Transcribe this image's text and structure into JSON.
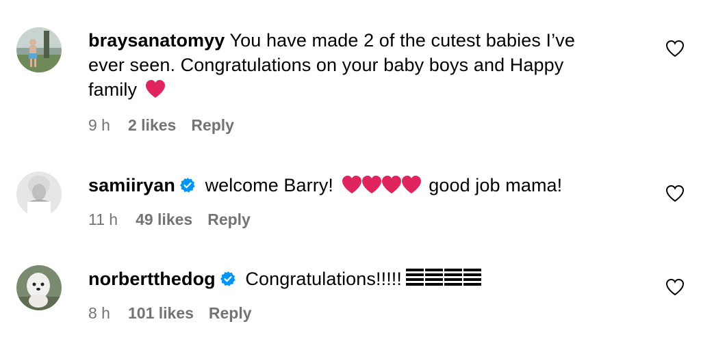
{
  "comments": [
    {
      "username": "braysanatomyy",
      "text_line1": " You have made 2 of the cutest babies I’ve",
      "text_line2": "ever seen. Congratulations on your baby boys and Happy",
      "text_line3": "family",
      "verified": false,
      "time": "9 h",
      "likes": "2 likes",
      "reply": "Reply",
      "emoji": "red-heart"
    },
    {
      "username": "samiiryan",
      "text_before": " welcome Barry! ",
      "text_after": " good job mama!",
      "verified": true,
      "time": "11 h",
      "likes": "49 likes",
      "reply": "Reply",
      "emoji": "red-heart x4"
    },
    {
      "username": "norbertthedog",
      "text": " Congratulations!!!!!",
      "verified": true,
      "time": "8 h",
      "likes": "101 likes",
      "reply": "Reply",
      "emoji": "striped-block x4"
    }
  ],
  "icons": {
    "like": "heart-outline-icon",
    "verified": "verified-badge-icon"
  },
  "colors": {
    "text": "#000000",
    "meta": "#737373",
    "verified": "#0095f6",
    "heart": "#e0245e"
  }
}
